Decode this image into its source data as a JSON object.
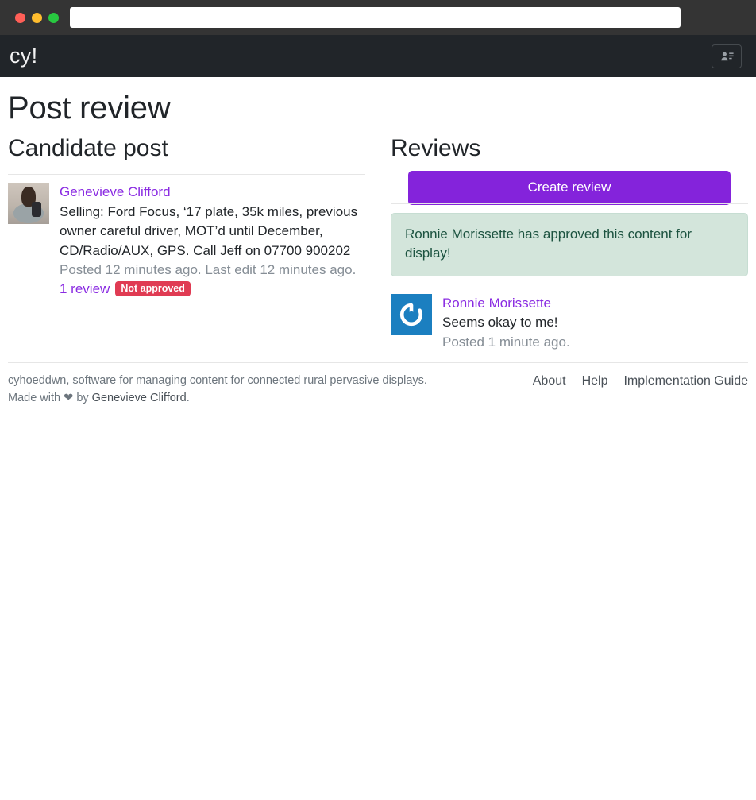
{
  "browser": {
    "url_value": "",
    "url_placeholder": "",
    "traffic_lights": [
      {
        "name": "close",
        "color": "#ff5f57"
      },
      {
        "name": "minimize",
        "color": "#ffbd2e"
      },
      {
        "name": "maximize",
        "color": "#28c840"
      }
    ]
  },
  "navbar": {
    "brand": "cy!",
    "account_icon": "contact-card-icon",
    "background": "#212529"
  },
  "page": {
    "title": "Post review"
  },
  "candidate": {
    "heading": "Candidate post",
    "author": "Genevieve Clifford",
    "avatar_icon": "user-photo-avatar",
    "body": "Selling: Ford Focus, ‘17 plate, 35k miles, previous owner careful driver, MOT’d until December, CD/Radio/AUX, GPS. Call Jeff on 07700 900202",
    "meta": "Posted 12 minutes ago. Last edit 12 minutes ago.",
    "review_count_label": "1 review",
    "status_badge": "Not approved",
    "status_badge_color": "#e03b53",
    "link_color": "#8a2be2"
  },
  "reviews": {
    "heading": "Reviews",
    "create_button": "Create review",
    "create_button_color": "#8423db",
    "alert": {
      "message": "Ronnie Morissette has approved this content for display!",
      "background": "#d3e5db",
      "text_color": "#1c5340"
    },
    "items": [
      {
        "author": "Ronnie Morissette",
        "avatar_icon": "gravatar-logo-avatar",
        "avatar_background": "#1b7fc0",
        "body": "Seems okay to me!",
        "meta": "Posted 1 minute ago."
      }
    ]
  },
  "footer": {
    "tagline": "cyhoeddwn, software for managing content for connected rural pervasive displays.",
    "made_with_prefix": "Made with",
    "heart": "❤",
    "made_with_middle": "by",
    "author": "Genevieve Clifford",
    "made_with_suffix": ".",
    "links": [
      {
        "label": "About"
      },
      {
        "label": "Help"
      },
      {
        "label": "Implementation Guide"
      }
    ]
  }
}
